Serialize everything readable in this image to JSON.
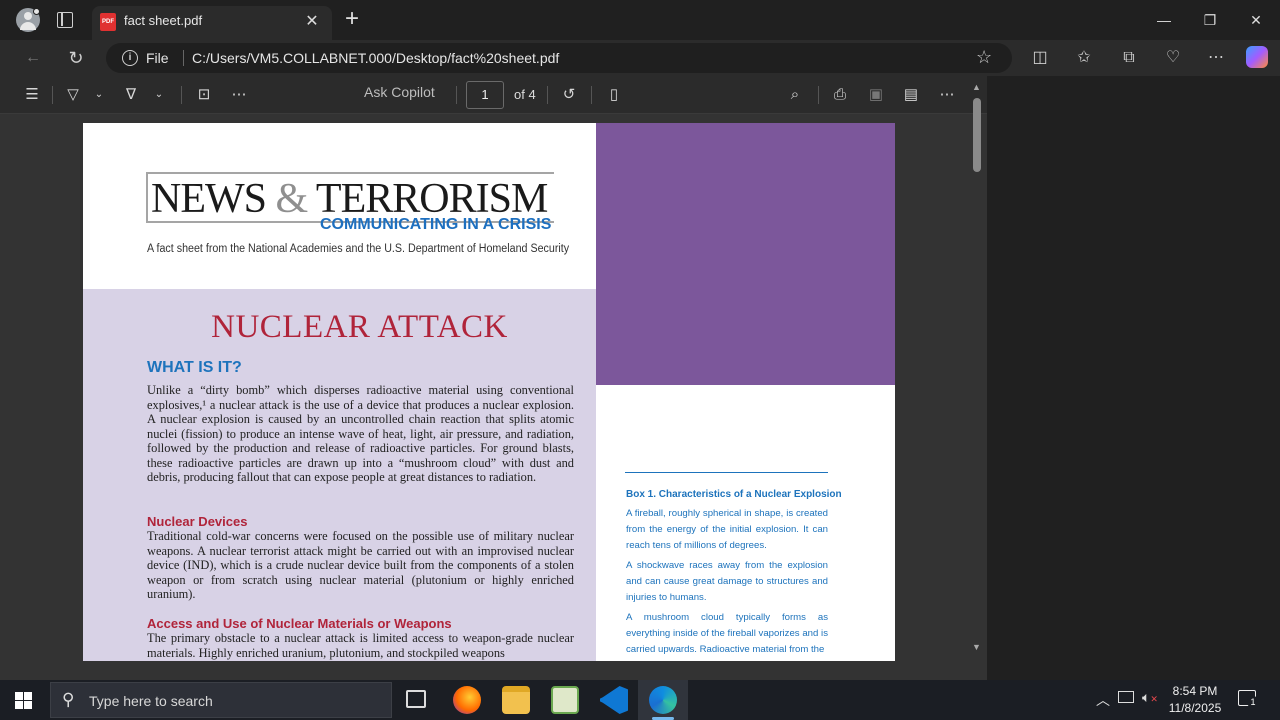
{
  "browser": {
    "tab_title": "fact sheet.pdf",
    "new_tab": "+",
    "address_prefix": "File",
    "url": "C:/Users/VM5.COLLABNET.000/Desktop/fact%20sheet.pdf"
  },
  "pdf_toolbar": {
    "ask_copilot": "Ask Copilot",
    "current_page": "1",
    "page_count": "of 4"
  },
  "document": {
    "logo_main_a": "NEWS ",
    "logo_amp": "&",
    "logo_main_b": " TERRORISM",
    "logo_sub": "COMMUNICATING IN A CRISIS",
    "fact_line": "A fact sheet from the National Academies and the U.S. Department of Homeland Security",
    "title": "NUCLEAR ATTACK",
    "section1_heading": "WHAT IS IT?",
    "section1_para": "Unlike a “dirty bomb” which disperses radioactive material using conventional explosives,¹ a nuclear attack is the use of a device that produces a nuclear explosion. A nuclear explosion is caused by an uncontrolled chain reaction that splits atomic nuclei (fission) to produce an intense wave of heat, light, air pressure, and radiation, followed by the production and release of radioactive particles. For ground blasts, these radioactive particles are drawn up into a “mushroom cloud” with dust and debris, producing fallout that can expose people at great distances to radiation.",
    "section2_heading": "Nuclear Devices",
    "section2_para": "Traditional cold-war concerns were focused on the possible use of military nuclear weapons. A nuclear terrorist attack might be carried out with an improvised nuclear device (IND), which is a crude nuclear device built from the components of a stolen weapon or from scratch using nuclear material (plutonium or highly enriched uranium).",
    "section3_heading": "Access and Use of Nuclear Materials or Weapons",
    "section3_para": "The primary obstacle to a nuclear attack is limited access to weapon-grade nuclear materials. Highly enriched uranium, plutonium, and stockpiled weapons",
    "box_title": "Box 1. Characteristics of a Nuclear Explosion",
    "box_items": [
      "A fireball, roughly spherical in shape, is created from the energy of the initial explosion. It can reach tens of millions of degrees.",
      "A shockwave races away from the explosion and can cause great damage to structures and injuries to humans.",
      "A mushroom cloud typically forms as everything inside of the fireball vaporizes and is carried upwards. Radioactive material from the"
    ]
  },
  "taskbar": {
    "search_placeholder": "Type here to search",
    "time": "8:54 PM",
    "date": "11/8/2025",
    "notification_count": "1"
  },
  "colors": {
    "accent_red": "#b0243a",
    "accent_blue": "#1d73bc",
    "purple_block": "#7c579b",
    "lavender": "#d8d2e6"
  }
}
